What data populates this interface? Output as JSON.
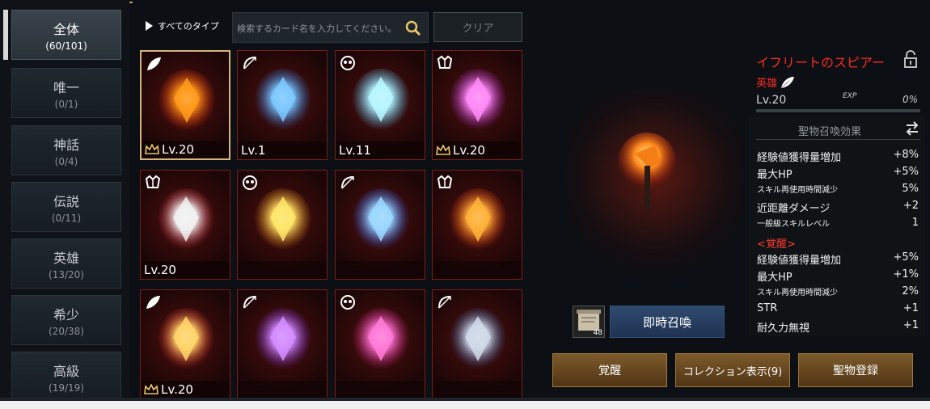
{
  "tabs": [
    {
      "name": "全体",
      "count": "(60/101)"
    },
    {
      "name": "唯一",
      "count": "(0/1)"
    },
    {
      "name": "神話",
      "count": "(0/4)"
    },
    {
      "name": "伝説",
      "count": "(0/11)"
    },
    {
      "name": "英雄",
      "count": "(13/20)"
    },
    {
      "name": "希少",
      "count": "(20/38)"
    },
    {
      "name": "高級",
      "count": "(19/19)"
    }
  ],
  "filter": {
    "type_label": "すべてのタイプ",
    "search_placeholder": "検索するカード名を入力してください。",
    "clear_label": "クリア"
  },
  "cards": [
    {
      "level": "Lv.20",
      "crown": true,
      "badge": "leaf-badge-icon",
      "art": "fire-axe"
    },
    {
      "level": "Lv.1",
      "crown": false,
      "badge": "bow-badge-icon",
      "art": "blue-bow"
    },
    {
      "level": "Lv.11",
      "crown": false,
      "badge": "mask-badge-icon",
      "art": "ice-crown"
    },
    {
      "level": "Lv.20",
      "crown": true,
      "badge": "crest-badge-icon",
      "art": "purple-staff"
    },
    {
      "level": "Lv.20",
      "crown": false,
      "badge": "crest-badge-icon",
      "art": "silver-helm"
    },
    {
      "level": "",
      "crown": false,
      "badge": "mask-badge-icon",
      "art": "sun-mace"
    },
    {
      "level": "",
      "crown": false,
      "badge": "bow-badge-icon",
      "art": "lightning-bow"
    },
    {
      "level": "",
      "crown": false,
      "badge": "crest-badge-icon",
      "art": "flame-skull"
    },
    {
      "level": "Lv.20",
      "crown": true,
      "badge": "leaf-badge-icon",
      "art": "horned-helm"
    },
    {
      "level": "",
      "crown": false,
      "badge": "bow-badge-icon",
      "art": "violet-wing"
    },
    {
      "level": "",
      "crown": false,
      "badge": "mask-badge-icon",
      "art": "pink-lantern"
    },
    {
      "level": "",
      "crown": false,
      "badge": "bow-badge-icon",
      "art": "blue-boots"
    }
  ],
  "detail": {
    "name": "イフリートのスピアー",
    "rarity": "英雄",
    "level": "Lv.20",
    "exp_label": "EXP",
    "exp_value": "0%",
    "exp_fraction": 0,
    "effects_title": "聖物召喚効果",
    "effects": [
      {
        "label": "経験値獲得量増加",
        "value": "+8%"
      },
      {
        "label": "最大HP",
        "value": "+5%"
      },
      {
        "label": "スキル再使用時間減少",
        "value": "5%"
      },
      {
        "label": "近距離ダメージ",
        "value": "+2"
      },
      {
        "label": "一般級スキルレベル",
        "value": "1"
      }
    ],
    "awaken_header": "<覚醒>",
    "awaken_effects": [
      {
        "label": "経験値獲得量増加",
        "value": "+5%"
      },
      {
        "label": "最大HP",
        "value": "+1%"
      },
      {
        "label": "スキル再使用時間減少",
        "value": "2%"
      },
      {
        "label": "STR",
        "value": "+1"
      },
      {
        "label": "耐久力無視",
        "value": "+1"
      }
    ]
  },
  "summon": {
    "scroll_count": "48",
    "button_label": "即時召喚"
  },
  "actions": {
    "awaken": "覚醒",
    "collection": "コレクション表示(9)",
    "register": "聖物登録"
  },
  "colors": {
    "rarity_red": "#ff2a22",
    "gold_border": "#d7b478",
    "card_border": "#7a1d1a"
  }
}
